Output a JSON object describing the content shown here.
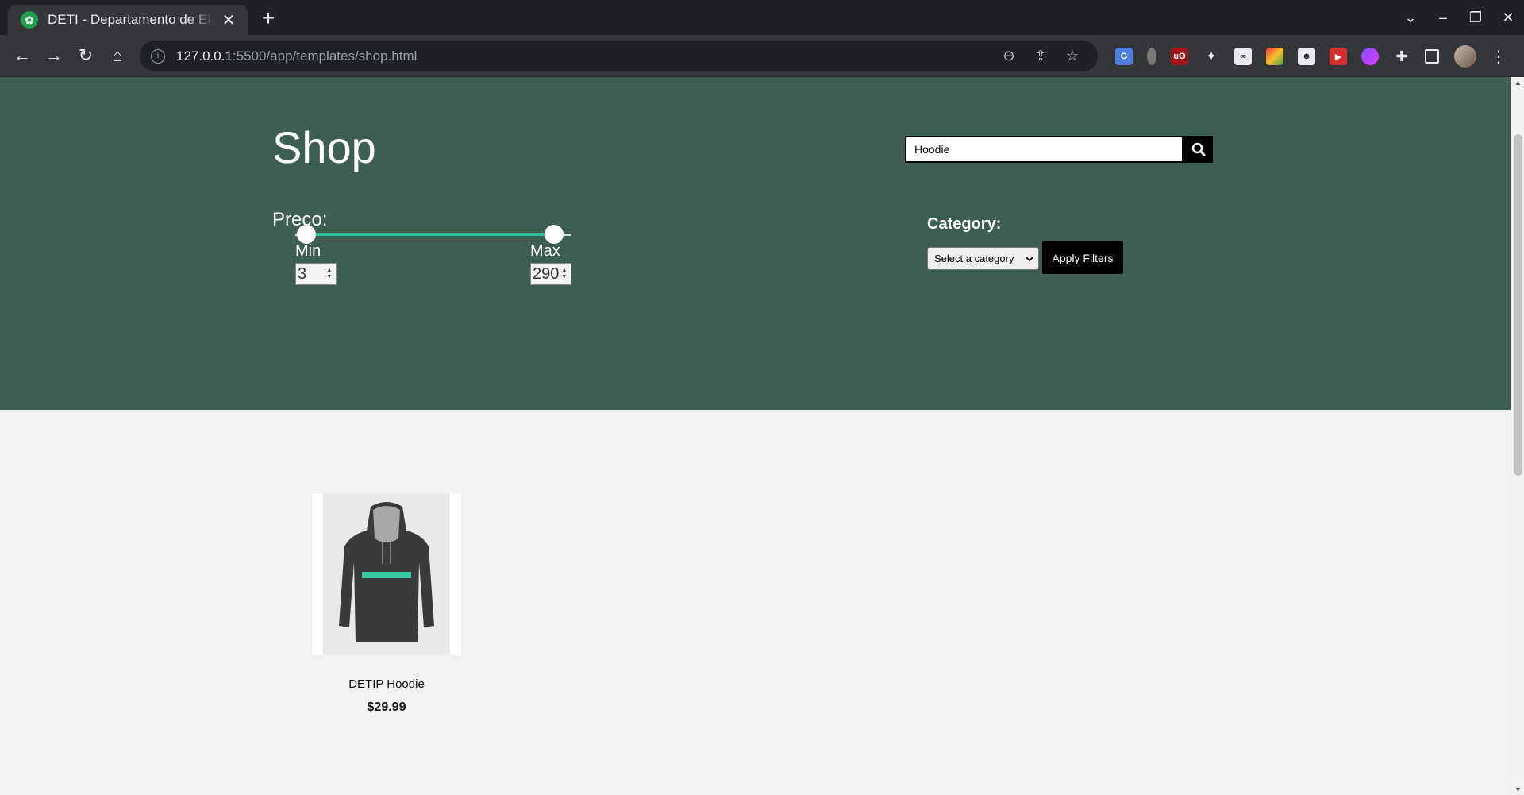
{
  "browser": {
    "tab_title": "DETI - Departamento de Electrónica",
    "url_host": "127.0.0.1",
    "url_rest": ":5500/app/templates/shop.html"
  },
  "page": {
    "title": "Shop",
    "search": {
      "value": "Hoodie"
    },
    "price_filter": {
      "label": "Preco:",
      "min_label": "Min",
      "max_label": "Max",
      "min_value": "3",
      "max_value": "290"
    },
    "category_filter": {
      "label": "Category:",
      "selected": "Select a category"
    },
    "apply_label": "Apply Filters",
    "products": [
      {
        "name": "DETIP Hoodie",
        "price": "$29.99"
      }
    ]
  },
  "colors": {
    "hero_bg": "#3d5f51",
    "slider_fill": "#2bbf9b",
    "page_bg": "#f2f2f2"
  }
}
